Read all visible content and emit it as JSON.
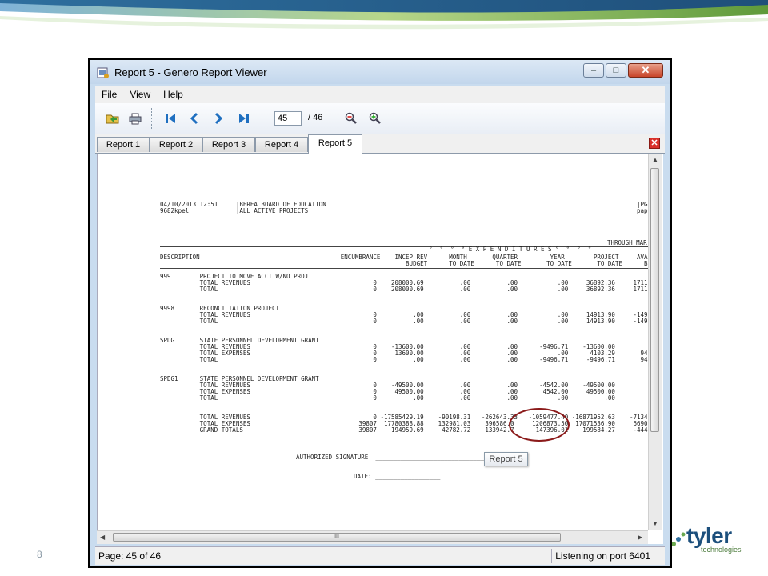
{
  "slide": {
    "page_number": "8",
    "brand": "tyler",
    "brand_sub": "technologies"
  },
  "window": {
    "title": "Report 5 - Genero Report Viewer",
    "min_glyph": "‒",
    "max_glyph": "□",
    "close_glyph": "✕"
  },
  "menu": [
    "File",
    "View",
    "Help"
  ],
  "toolbar": {
    "page_value": "45",
    "page_total": "/ 46"
  },
  "tabs": [
    "Report 1",
    "Report 2",
    "Report 3",
    "Report 4",
    "Report 5"
  ],
  "tab_close_glyph": "✕",
  "status": {
    "page": "Page: 45 of 46",
    "listening": "Listening on port 6401"
  },
  "callout": "Report 5",
  "hscroll_grip": "III",
  "report": {
    "header": [
      "04/10/2013 12:51     |BEREA BOARD OF EDUCATION",
      "9682kpel             |ALL ACTIVE PROJECTS"
    ],
    "header_right": [
      "|PG",
      "pap"
    ],
    "through": "THROUGH MAR",
    "col_head_1": "  °  °  °  ° E X P E N D I T U R E S °  °  °  °",
    "col_head_2": "DESCRIPTION                                       ENCUMBRANCE    INCEP REV      MONTH       QUARTER         YEAR        PROJECT     AVAIL",
    "col_head_3": "                                                                    BUDGET      TO DATE      TO DATE       TO DATE       TO DATE      BUD",
    "lines": [
      "999        PROJECT TO MOVE ACCT W/NO PROJ",
      "           TOTAL REVENUES                                  0    208000.69          .00          .00           .00     36892.36     1711",
      "           TOTAL                                           0    208000.69          .00          .00           .00     36892.36     1711",
      "",
      "",
      "9998       RECONCILIATION PROJECT",
      "           TOTAL REVENUES                                  0          .00          .00          .00           .00     14913.90     -149",
      "           TOTAL                                           0          .00          .00          .00           .00     14913.90     -149",
      "",
      "",
      "SPDG       STATE PERSONNEL DEVELOPMENT GRANT",
      "           TOTAL REVENUES                                  0    -13600.00          .00          .00      -9496.71    -13600.00",
      "           TOTAL EXPENSES                                  0     13600.00          .00          .00           .00      4103.29       94",
      "           TOTAL                                           0          .00          .00          .00      -9496.71     -9496.71       94",
      "",
      "",
      "SPDG1      STATE PERSONNEL DEVELOPMENT GRANT",
      "           TOTAL REVENUES                                  0    -49500.00          .00          .00      -4542.00    -49500.00",
      "           TOTAL EXPENSES                                  0     49500.00          .00          .00       4542.00     49500.00",
      "           TOTAL                                           0          .00          .00          .00           .00          .00",
      "",
      "",
      "           TOTAL REVENUES                                  0 -17585429.19    -90198.31   -262643.33   -1059477.40 -16871952.63    -7134",
      "           TOTAL EXPENSES                              39807  17780388.88    132981.03    396586.0     1206873.50  17071536.90     6690",
      "           GRAND TOTALS                                39807    194959.69     42782.72    133942.7      147396.01    199584.27     -444"
    ],
    "signature": "AUTHORIZED SIGNATURE: ______________________________________",
    "date": "DATE: __________________"
  }
}
